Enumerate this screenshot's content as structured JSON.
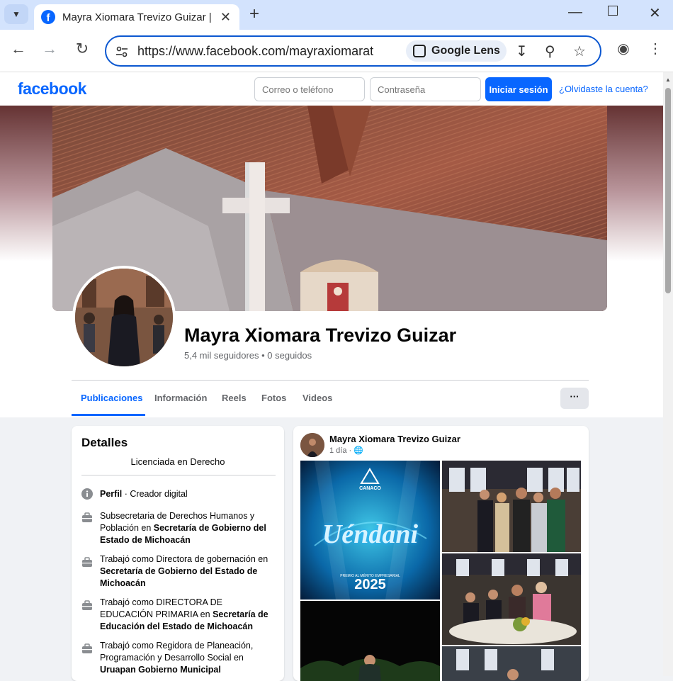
{
  "browser": {
    "tab_title": "Mayra Xiomara Trevizo Guizar |",
    "url": "https://www.facebook.com/mayraxiomarat",
    "lens_label": "Google Lens"
  },
  "fb_header": {
    "logo": "facebook",
    "email_placeholder": "Correo o teléfono",
    "password_placeholder": "Contraseña",
    "login_label": "Iniciar sesión",
    "forgot_label": "¿Olvidaste la cuenta?"
  },
  "profile": {
    "name": "Mayra Xiomara Trevizo Guizar",
    "stats": "5,4 mil seguidores • 0 seguidos",
    "tabs": [
      "Publicaciones",
      "Información",
      "Reels",
      "Fotos",
      "Videos"
    ],
    "more_label": "···"
  },
  "details": {
    "title": "Detalles",
    "bio": "Licenciada en Derecho",
    "perfil_label": "Perfil",
    "perfil_value": " · Creador digital",
    "jobs": [
      {
        "pre": "Subsecretaria de Derechos Humanos y Población en ",
        "org": "Secretaría de Gobierno del Estado de Michoacán"
      },
      {
        "pre": "Trabajó como Directora de gobernación en ",
        "org": "Secretaría de Gobierno del Estado de Michoacán"
      },
      {
        "pre": "Trabajó como DIRECTORA DE EDUCACIÓN PRIMARIA en ",
        "org": "Secretaría de Educación del Estado de Michoacán"
      },
      {
        "pre": "Trabajó como Regidora de Planeación, Programación y Desarrollo Social en ",
        "org": "Uruapan Gobierno Municipal"
      }
    ]
  },
  "post": {
    "author": "Mayra Xiomara Trevizo Guizar",
    "time": "1 día · ",
    "banner": {
      "org": "CANACO",
      "title": "Uéndani",
      "subtitle": "PREMIO AL MÉRITO EMPRESARIAL",
      "year": "2025"
    }
  },
  "colors": {
    "fb_blue": "#0866ff",
    "chrome_tabstrip": "#d3e3fd"
  }
}
